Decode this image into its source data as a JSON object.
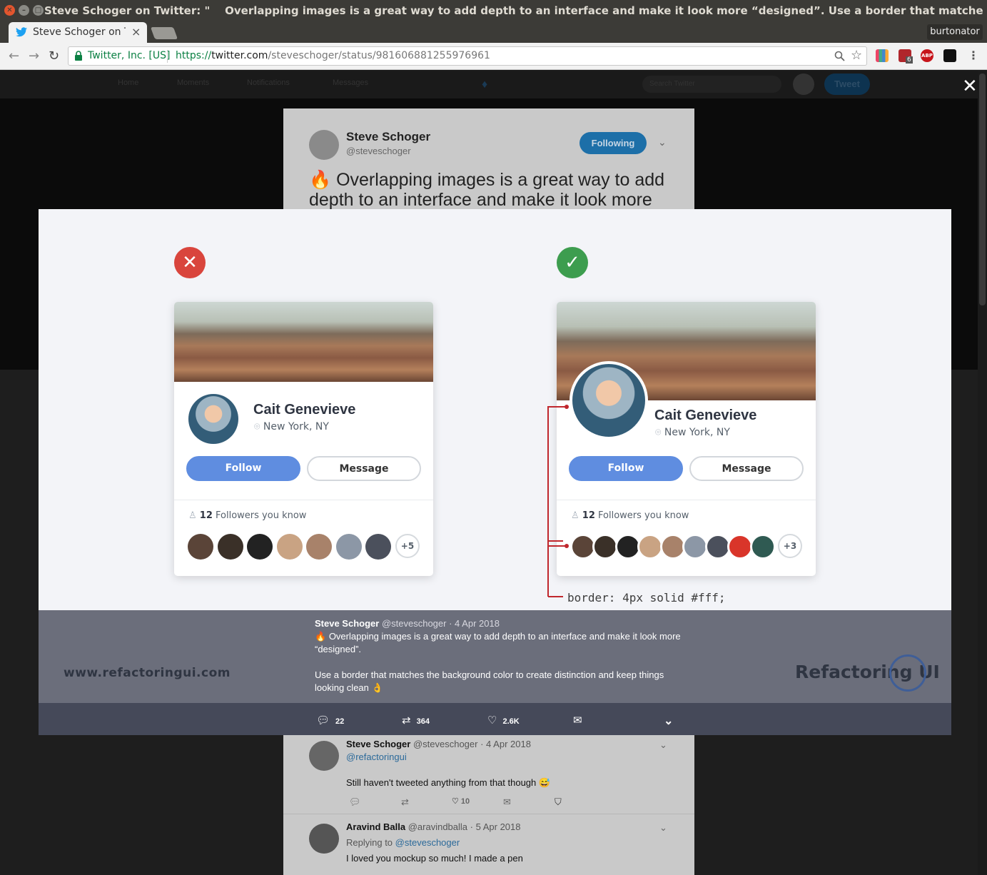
{
  "window": {
    "title": "Steve Schoger on Twitter: \"    Overlapping images is a great way to add depth to an interface and make it look more “designed”. Use a border that matches the background color to ..."
  },
  "tab": {
    "title": "Steve Schoger on Tw",
    "close": "×"
  },
  "profile": "burtonator",
  "toolbar": {
    "secure_label": "Twitter, Inc. [US]",
    "url_scheme": "https://",
    "url_host": "twitter.com",
    "url_path": "/steveschoger/status/981606881255976961",
    "ext_badge": "6",
    "abp": "ABP"
  },
  "twitter_nav": {
    "home": "Home",
    "moments": "Moments",
    "notifications": "Notifications",
    "messages": "Messages",
    "search_placeholder": "Search Twitter",
    "tweet": "Tweet"
  },
  "tweet_bg": {
    "author": "Steve Schoger",
    "handle": "@steveschoger",
    "following": "Following",
    "text": "Overlapping images is a great way to add depth to an interface and make it look more"
  },
  "image": {
    "bad_card": {
      "name": "Cait Genevieve",
      "location": "New York, NY",
      "follow": "Follow",
      "message": "Message",
      "followers_count": "12",
      "followers_label": "Followers you know",
      "more": "+5"
    },
    "good_card": {
      "name": "Cait Genevieve",
      "location": "New York, NY",
      "follow": "Follow",
      "message": "Message",
      "followers_count": "12",
      "followers_label": "Followers you know",
      "more": "+3"
    },
    "code_note": "border: 4px solid #fff;",
    "colors": {
      "bad": "#d9453d",
      "good": "#3d9d4f",
      "accent": "#5f8de0",
      "annotation": "#c0272d"
    }
  },
  "overlay": {
    "site": "www.refactoringui.com",
    "logo": "Refactoring UI",
    "author": "Steve Schoger",
    "handle": "@steveschoger",
    "date": "· 4 Apr 2018",
    "line1": "Overlapping images is a great way to add depth to an interface and make it look more “designed”.",
    "line2": "Use a border that matches the background color to create distinction and keep things looking clean"
  },
  "actions": {
    "replies": "22",
    "retweets": "364",
    "likes": "2.6K"
  },
  "replies": [
    {
      "author": "Steve Schoger",
      "handle": "@steveschoger",
      "date": "· 4 Apr 2018",
      "mention": "@refactoringui",
      "text": "Still haven't tweeted anything from that though",
      "likes": "10"
    },
    {
      "author": "Aravind Balla",
      "handle": "@aravindballa",
      "date": "· 5 Apr 2018",
      "replying": "Replying to",
      "mention": "@steveschoger",
      "text": "I loved you mockup so much! I made a pen"
    }
  ]
}
